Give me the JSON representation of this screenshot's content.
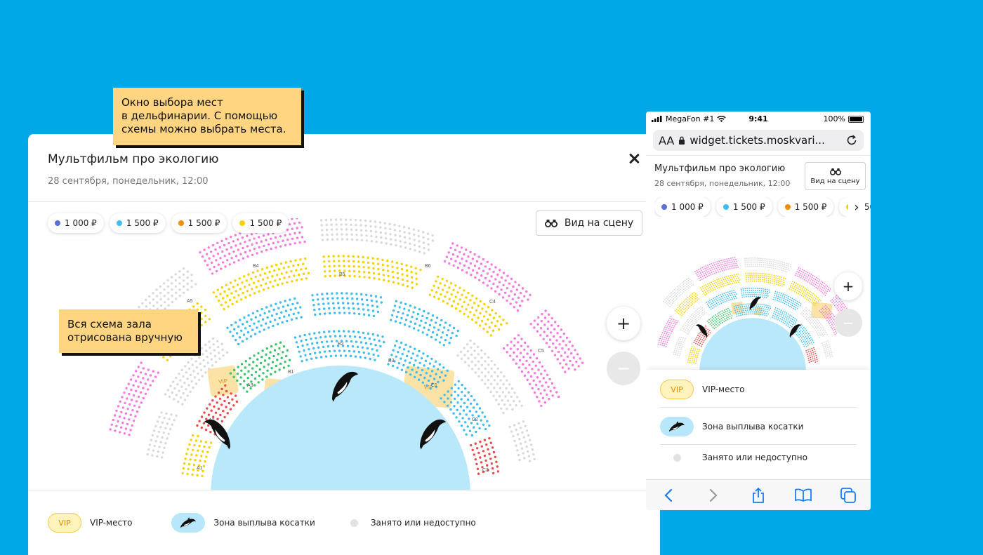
{
  "event": {
    "title": "Мультфильм про экологию",
    "datetime": "28 сентября, понедельник, 12:00"
  },
  "prices": [
    {
      "label": "1 000 ₽",
      "color": "#5b6fd6"
    },
    {
      "label": "1 500 ₽",
      "color": "#3fbdf0"
    },
    {
      "label": "1 500 ₽",
      "color": "#f28c00"
    },
    {
      "label": "1 500 ₽",
      "color": "#f7d200"
    }
  ],
  "stage_button": "Вид на сцену",
  "zoom": {
    "in": "+",
    "out": "−"
  },
  "legend": {
    "vip_badge": "VIP",
    "vip_label": "VIP-место",
    "orca_label": "Зона выплыва косатки",
    "occupied_label": "Занято или недоступно"
  },
  "hall": {
    "vip_label": "VIP",
    "sector_labels": {
      "A1": "A1",
      "A2": "A2",
      "A3": "A3",
      "A5": "A5",
      "B1": "B1",
      "B2": "B2",
      "B3": "B3",
      "B4": "B4",
      "B5": "B5",
      "B6": "B6",
      "C1": "C1",
      "C2": "C2",
      "C3": "C3",
      "C4": "C4",
      "C5": "C5"
    },
    "colors": {
      "pool": "#b9e8fb",
      "pink": "#f47adf",
      "yellow": "#f7d200",
      "blue": "#3fbdf0",
      "green": "#3cc46b",
      "red": "#e84b4b",
      "orange": "#f28c00",
      "gray": "#d9d9d9",
      "vip_zone": "#fbe3a8"
    }
  },
  "annotations": {
    "top": "Окно выбора мест\nв дельфинарии. С помощью\nсхемы можно выбрать места.",
    "left": "Вся схема зала\nотрисована вручную"
  },
  "phone": {
    "carrier": "MegaFon #1",
    "time": "9:41",
    "battery": "100%",
    "text_size": "AA",
    "url": "widget.tickets.moskvari...",
    "chevron": "›"
  }
}
